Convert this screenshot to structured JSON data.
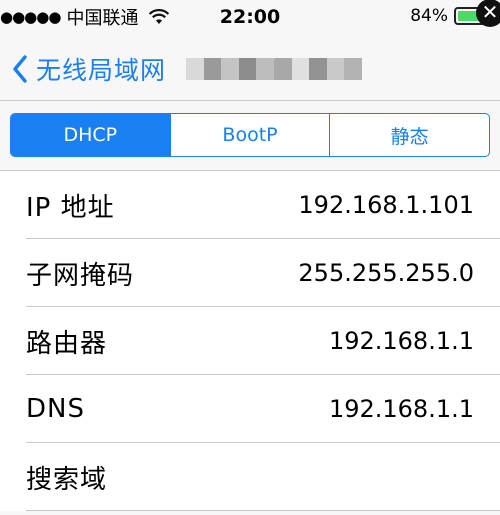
{
  "status_bar": {
    "signal": "●●●●●",
    "carrier": "中国联通",
    "time": "22:00",
    "battery_percent": "84%",
    "battery_level": 0.84,
    "battery_close_glyph": "✕"
  },
  "nav": {
    "back_label": "无线局域网"
  },
  "segments": [
    {
      "label": "DHCP",
      "selected": true
    },
    {
      "label": "BootP",
      "selected": false
    },
    {
      "label": "静态",
      "selected": false
    }
  ],
  "rows": [
    {
      "label": "IP 地址",
      "value": "192.168.1.101"
    },
    {
      "label": "子网掩码",
      "value": "255.255.255.0"
    },
    {
      "label": "路由器",
      "value": "192.168.1.1"
    },
    {
      "label": "DNS",
      "value": "192.168.1.1"
    },
    {
      "label": "搜索域",
      "value": ""
    }
  ],
  "colors": {
    "accent": "#1a7ff0",
    "battery_green": "#4cd964",
    "separator": "#c8c7cc"
  }
}
